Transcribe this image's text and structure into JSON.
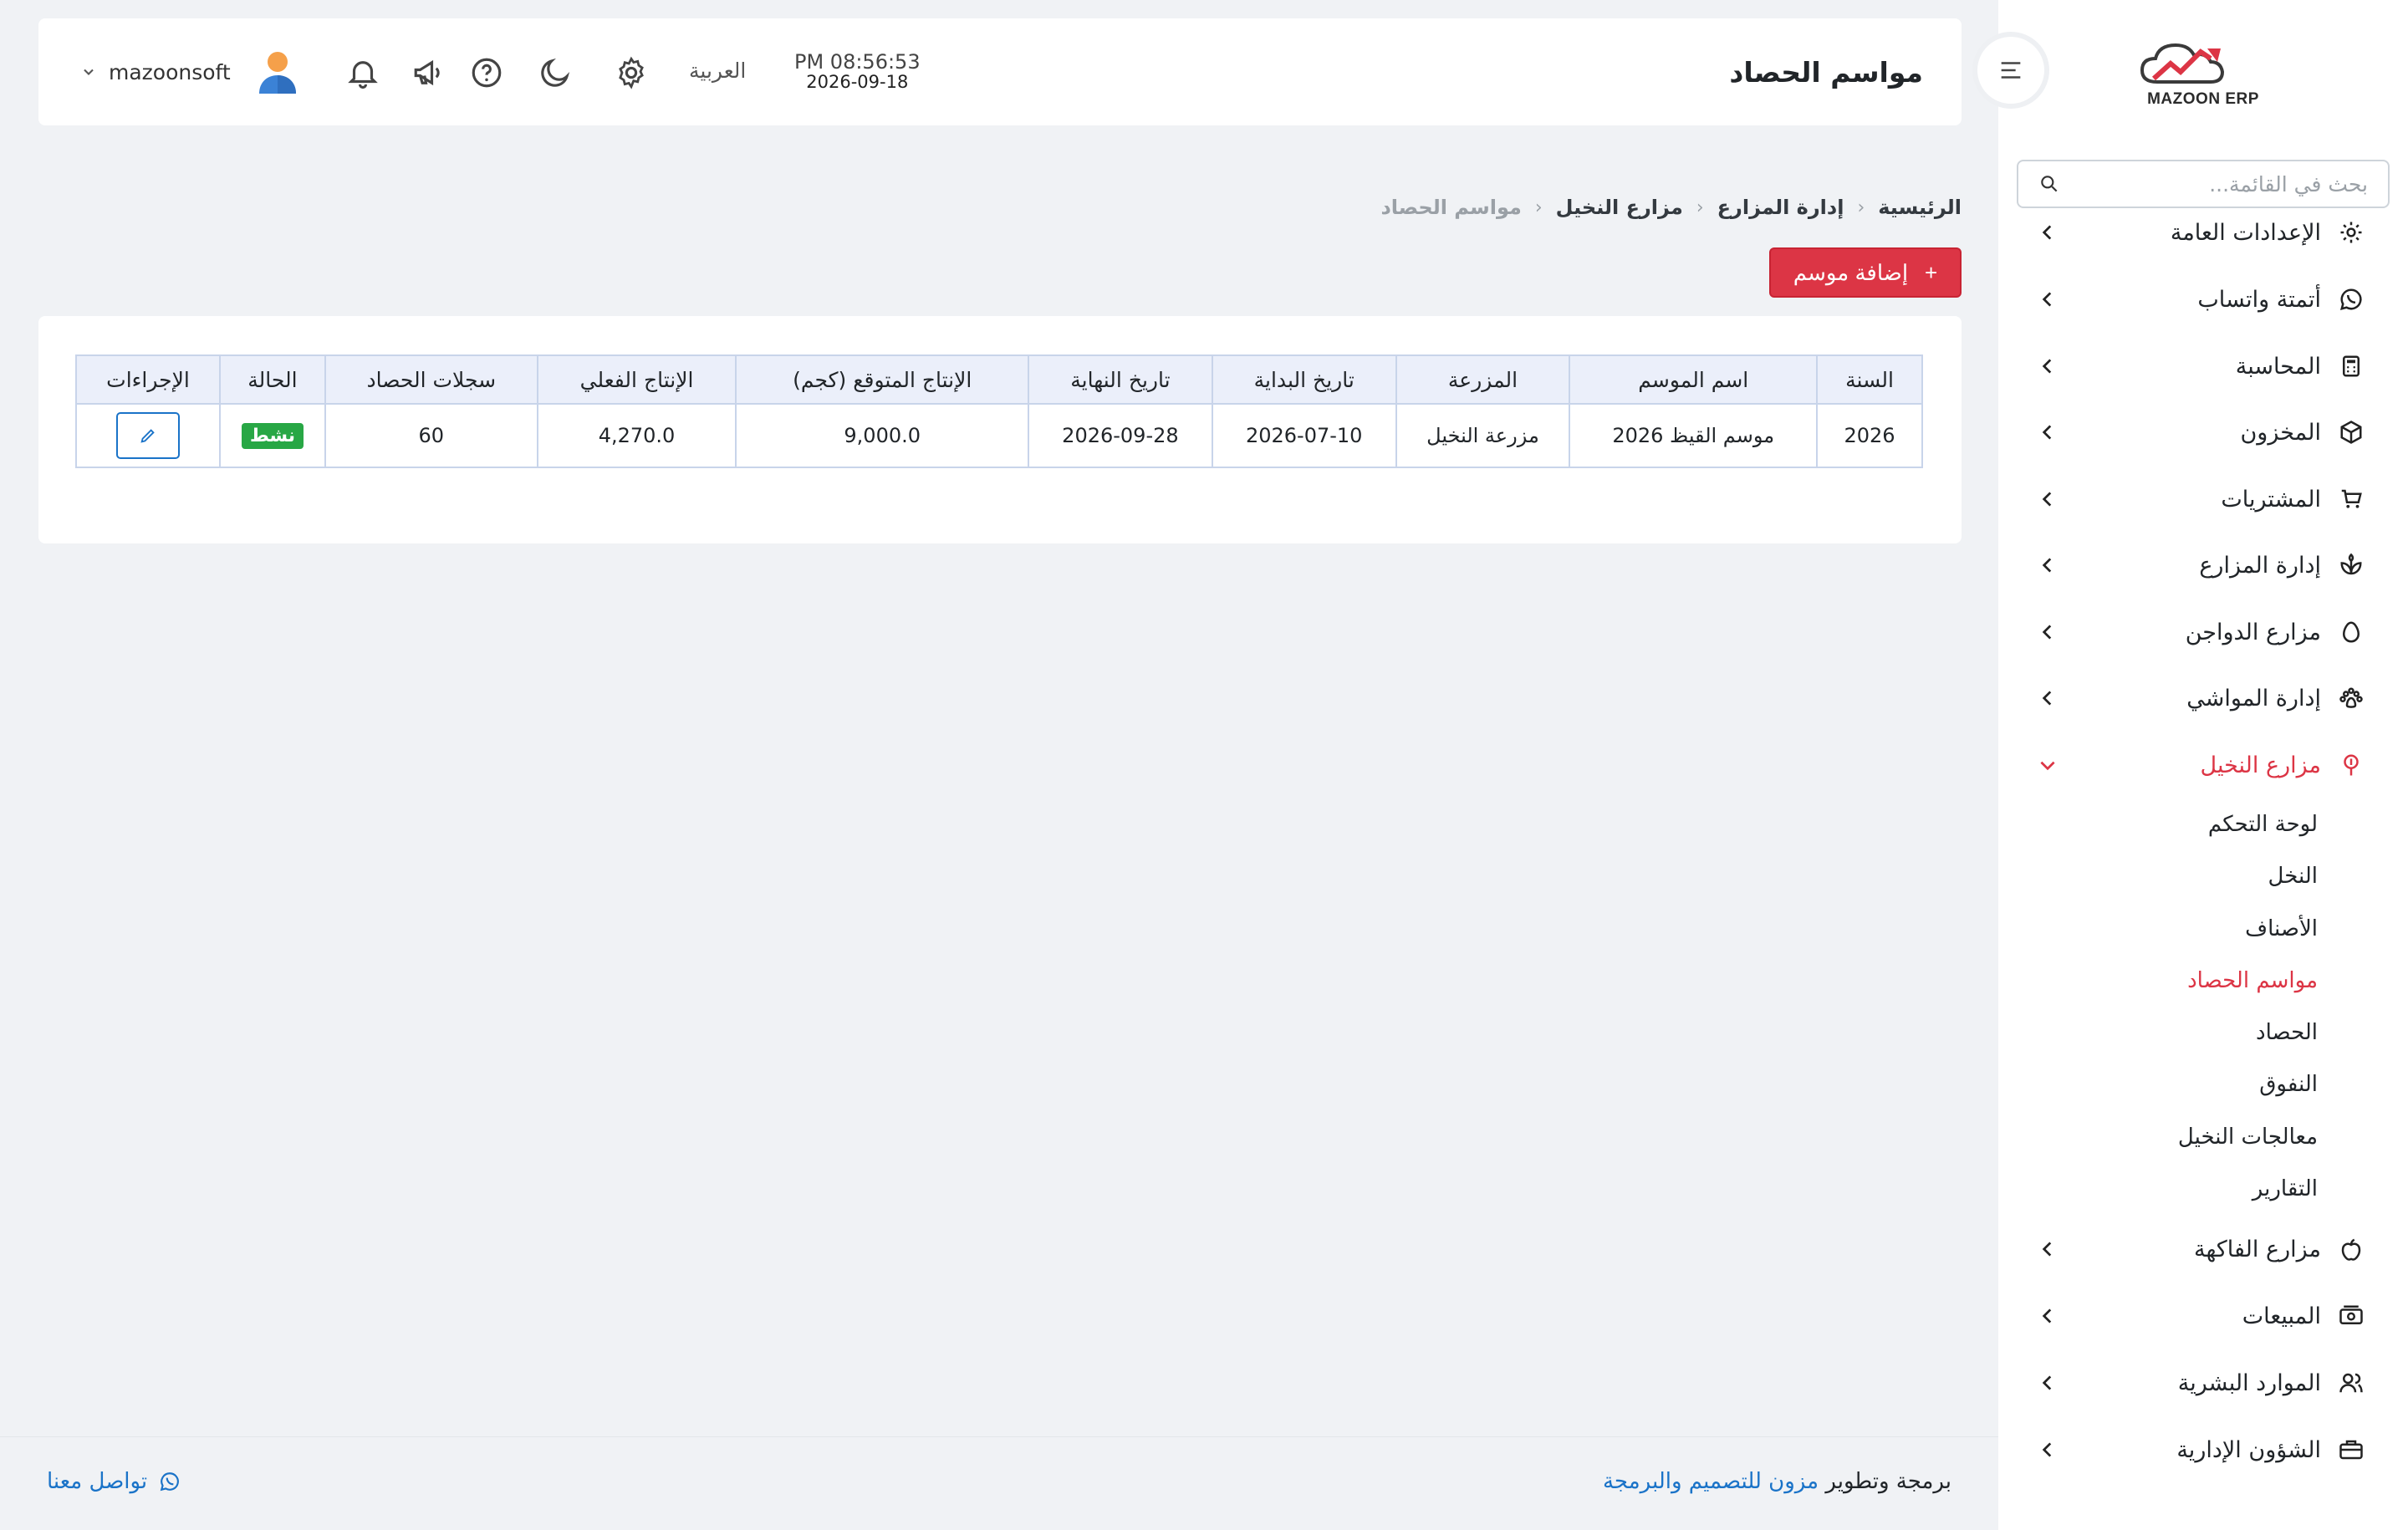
{
  "brand": {
    "name": "MAZOON ERP",
    "colors": {
      "accent": "#dc3545",
      "link": "#1a73c8",
      "success": "#28a745",
      "background": "#f0f2f5"
    }
  },
  "header": {
    "title": "مواسم الحصاد",
    "time": "PM 08:56:53",
    "date": "2026-09-18",
    "language": "العربية",
    "username": "mazoonsoft",
    "icons": [
      "gear-icon",
      "moon-icon",
      "help-icon",
      "megaphone-icon",
      "bell-icon"
    ]
  },
  "sidebar": {
    "search_placeholder": "بحث في القائمة...",
    "items": [
      {
        "label": "الإعدادات العامة",
        "icon": "gear-icon"
      },
      {
        "label": "أتمتة واتساب",
        "icon": "whatsapp-icon"
      },
      {
        "label": "المحاسبة",
        "icon": "calculator-icon"
      },
      {
        "label": "المخزون",
        "icon": "box-icon"
      },
      {
        "label": "المشتريات",
        "icon": "cart-icon"
      },
      {
        "label": "إدارة المزارع",
        "icon": "plant-icon"
      },
      {
        "label": "مزارع الدواجن",
        "icon": "egg-icon"
      },
      {
        "label": "إدارة المواشي",
        "icon": "paw-icon"
      },
      {
        "label": "مزارع النخيل",
        "icon": "palm-icon",
        "expanded": true
      },
      {
        "label": "مزارع الفاكهة",
        "icon": "apple-icon"
      },
      {
        "label": "المبيعات",
        "icon": "cash-icon"
      },
      {
        "label": "الموارد البشرية",
        "icon": "users-icon"
      },
      {
        "label": "الشؤون الإدارية",
        "icon": "briefcase-icon"
      }
    ],
    "sub_items": [
      {
        "label": "لوحة التحكم"
      },
      {
        "label": "النخل"
      },
      {
        "label": "الأصناف"
      },
      {
        "label": "مواسم الحصاد",
        "active": true
      },
      {
        "label": "الحصاد"
      },
      {
        "label": "النفوق"
      },
      {
        "label": "معالجات النخيل"
      },
      {
        "label": "التقارير"
      }
    ]
  },
  "breadcrumb": [
    "الرئيسية",
    "إدارة المزارع",
    "مزارع النخيل",
    "مواسم الحصاد"
  ],
  "add_button_label": "إضافة موسم",
  "table": {
    "headers": [
      "السنة",
      "اسم الموسم",
      "المزرعة",
      "تاريخ البداية",
      "تاريخ النهاية",
      "الإنتاج المتوقع (كجم)",
      "الإنتاج الفعلي",
      "سجلات الحصاد",
      "الحالة",
      "الإجراءات"
    ],
    "rows": [
      {
        "year": "2026",
        "season_name": "موسم القيظ 2026",
        "farm": "مزرعة النخيل",
        "start_date": "2026-07-10",
        "end_date": "2026-09-28",
        "expected_production": "9,000.0",
        "actual_production": "4,270.0",
        "harvest_records": "60",
        "status": "نشط"
      }
    ]
  },
  "footer": {
    "credit_prefix": "برمجة وتطوير",
    "credit_link": "مزون للتصميم والبرمجة",
    "contact": "تواصل معنا"
  }
}
